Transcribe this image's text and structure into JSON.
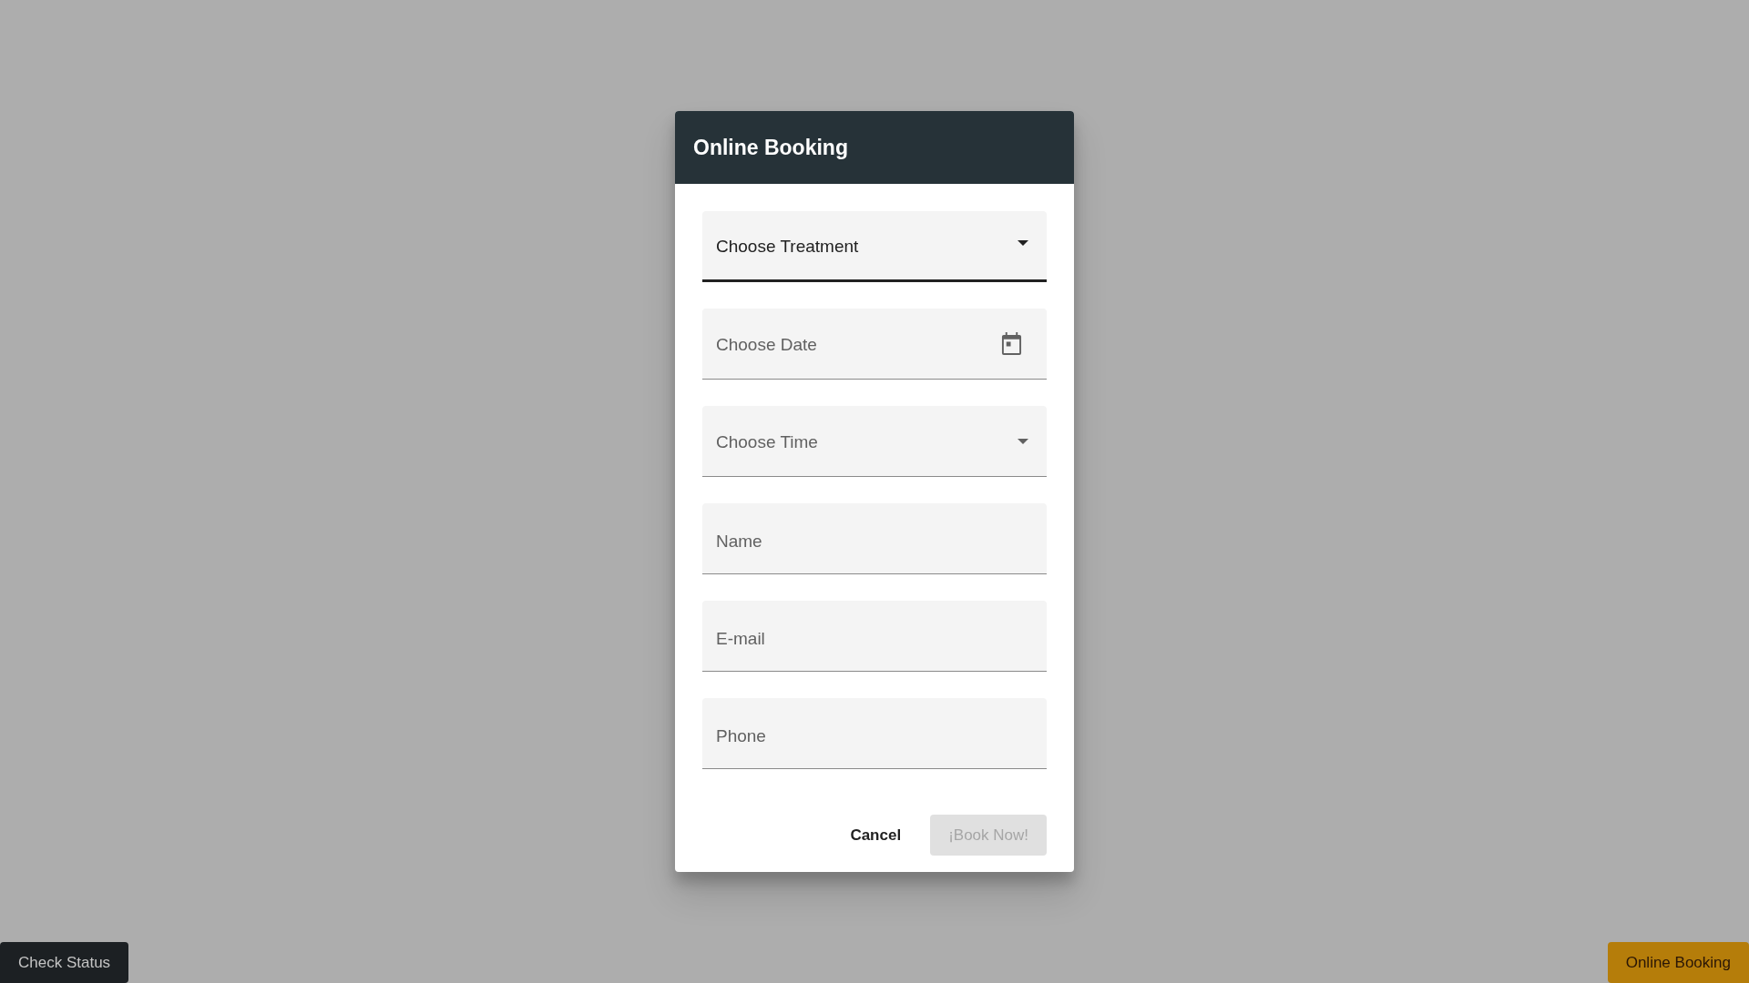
{
  "dialog": {
    "title": "Online Booking",
    "fields": [
      {
        "kind": "select",
        "placeholder": "Choose Treatment",
        "focused": true
      },
      {
        "kind": "date",
        "placeholder": "Choose Date",
        "focused": false
      },
      {
        "kind": "select",
        "placeholder": "Choose Time",
        "focused": false
      },
      {
        "kind": "text",
        "placeholder": "Name",
        "focused": false
      },
      {
        "kind": "text",
        "placeholder": "E-mail",
        "focused": false
      },
      {
        "kind": "text",
        "placeholder": "Phone",
        "focused": false
      }
    ],
    "buttons": [
      {
        "label": "Cancel",
        "kind": "text",
        "disabled": false
      },
      {
        "label": "¡Book Now!",
        "kind": "filled",
        "disabled": true
      }
    ]
  },
  "bottom_buttons": [
    {
      "label": "Check Status",
      "kind": "dark"
    },
    {
      "label": "Online Booking",
      "kind": "amber"
    }
  ]
}
